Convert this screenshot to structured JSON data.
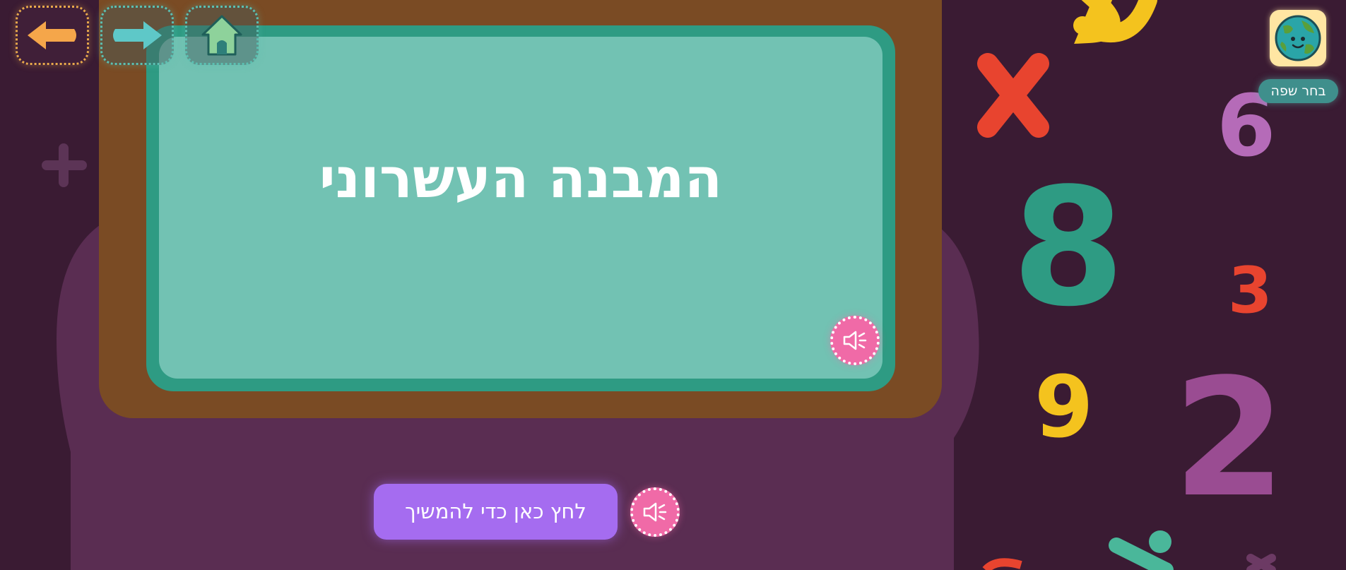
{
  "board": {
    "title": "המבנה העשרוני"
  },
  "continue_button": {
    "label": "לחץ כאן כדי להמשיך"
  },
  "language": {
    "label": "בחר שפה"
  },
  "colors": {
    "background": "#3a1b33",
    "board_frame": "#7a4b24",
    "board": "#72c2b3",
    "board_border": "#2e9b83",
    "accent_purple": "#a56cf0",
    "sound_pink": "#f06aa7",
    "back_orange": "#f5a64a",
    "forward_teal": "#5ec8c8"
  },
  "icons": {
    "back": "arrow-left-icon",
    "forward": "arrow-right-icon",
    "home": "home-icon",
    "language": "globe-icon",
    "sound": "speaker-icon"
  }
}
